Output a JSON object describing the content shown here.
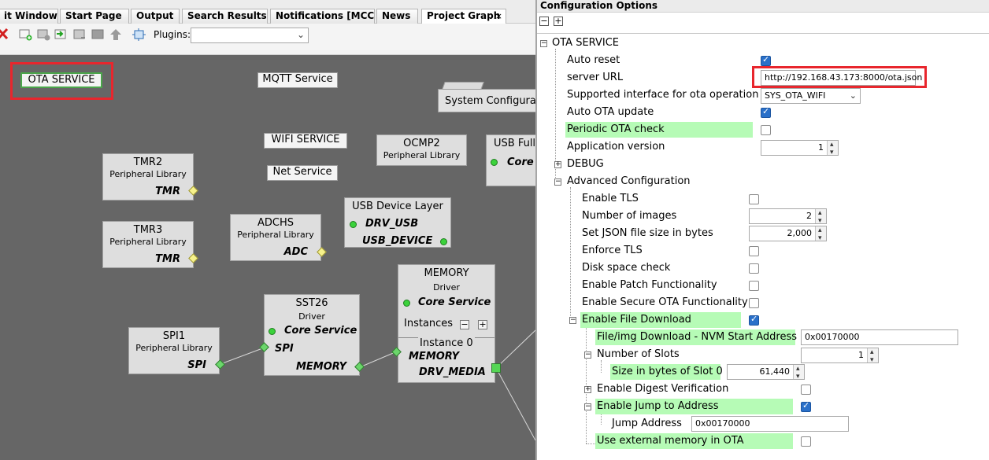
{
  "tabs": [
    {
      "label": "it Window",
      "active": false
    },
    {
      "label": "Start Page",
      "active": false
    },
    {
      "label": "Output",
      "active": false
    },
    {
      "label": "Search Results",
      "active": false
    },
    {
      "label": "Notifications [MCC]",
      "active": false
    },
    {
      "label": "News",
      "active": false
    },
    {
      "label": "Project Graph",
      "active": true,
      "close": "×"
    }
  ],
  "toolbar": {
    "icons": [
      "delete-icon",
      "add-component-icon",
      "remove-component-icon",
      "import-icon",
      "export-icon",
      "save-icon",
      "up-arrow-icon",
      "zoom-fit-icon"
    ],
    "plugins_label": "Plugins:",
    "plugins_value": ""
  },
  "graph": {
    "services": {
      "ota": "OTA SERVICE",
      "mqtt": "MQTT Service",
      "wifi": "WIFI SERVICE",
      "net": "Net Service",
      "system_config": "System Configurati"
    },
    "tmr2": {
      "title": "TMR2",
      "subtitle": "Peripheral Library",
      "port": "TMR"
    },
    "tmr3": {
      "title": "TMR3",
      "subtitle": "Peripheral Library",
      "port": "TMR"
    },
    "ocmp2": {
      "title": "OCMP2",
      "subtitle": "Peripheral Library"
    },
    "usb_full": {
      "title": "USB Full",
      "port": "Core"
    },
    "adchs": {
      "title": "ADCHS",
      "subtitle": "Peripheral Library",
      "port": "ADC"
    },
    "usb_device_layer": {
      "title": "USB Device Layer",
      "port1": "DRV_USB",
      "port2": "USB_DEVICE"
    },
    "spi1": {
      "title": "SPI1",
      "subtitle": "Peripheral Library",
      "port": "SPI"
    },
    "sst26": {
      "title": "SST26",
      "subtitle": "Driver",
      "port1": "Core Service",
      "port2": "SPI",
      "port3": "MEMORY"
    },
    "memory": {
      "title": "MEMORY",
      "subtitle": "Driver",
      "port1": "Core Service",
      "instances": "Instances",
      "minus": "−",
      "plus": "+",
      "instance": "Instance 0",
      "port2": "MEMORY",
      "port3": "DRV_MEDIA"
    }
  },
  "config": {
    "title": "Configuration Options",
    "collapse_all": "−",
    "expand_all": "+",
    "rows": {
      "ota_service": "OTA SERVICE",
      "auto_reset": "Auto reset",
      "server_url": "server URL",
      "server_url_value": "http://192.168.43.173:8000/ota.json",
      "supported_interface": "Supported interface for ota operation",
      "supported_interface_value": "SYS_OTA_WIFI",
      "auto_ota_update": "Auto OTA update",
      "periodic_ota_check": "Periodic OTA check",
      "application_version": "Application version",
      "application_version_value": "1",
      "debug": "DEBUG",
      "advanced_configuration": "Advanced Configuration",
      "enable_tls": "Enable TLS",
      "number_of_images": "Number of images",
      "number_of_images_value": "2",
      "json_file_size": "Set JSON file size in bytes",
      "json_file_size_value": "2,000",
      "enforce_tls": "Enforce TLS",
      "disk_space_check": "Disk space check",
      "enable_patch": "Enable Patch Functionality",
      "enable_secure_ota": "Enable Secure OTA Functionality",
      "enable_file_download": "Enable File Download",
      "nvm_start_address": "File/img Download - NVM Start Address",
      "nvm_start_address_value": "0x00170000",
      "number_of_slots": "Number of Slots",
      "number_of_slots_value": "1",
      "slot_size": "Size in bytes of Slot 0",
      "slot_size_value": "61,440",
      "enable_digest": "Enable Digest Verification",
      "enable_jump": "Enable Jump to Address",
      "jump_address": "Jump Address",
      "jump_address_value": "0x00170000",
      "use_external_memory": "Use external memory in OTA"
    },
    "checked": {
      "auto_reset": true,
      "auto_ota_update": true,
      "periodic_ota_check": false,
      "enable_tls": false,
      "enforce_tls": false,
      "disk_space_check": false,
      "enable_patch": false,
      "enable_secure_ota": false,
      "enable_file_download": true,
      "enable_digest": false,
      "enable_jump": true,
      "use_external_memory": false
    }
  },
  "colors": {
    "highlight": "#b6fbb6",
    "annotation": "#e8262d",
    "canvas": "#666666",
    "checkbox_on": "#2a70c9"
  }
}
